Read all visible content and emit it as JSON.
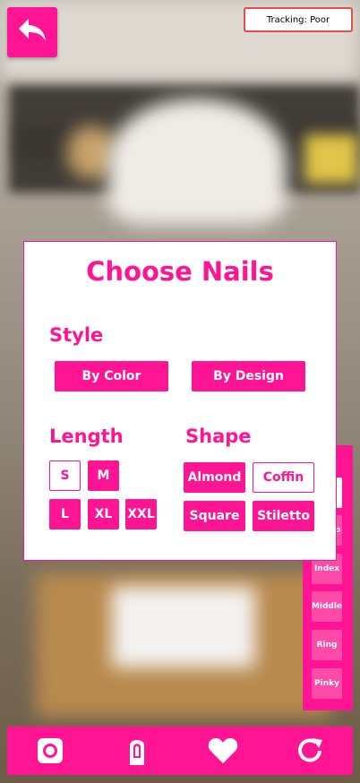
{
  "tracking": {
    "label": "Tracking: Poor"
  },
  "panel": {
    "title": "Choose Nails",
    "style": {
      "label": "Style",
      "options": [
        "By Color",
        "By Design"
      ]
    },
    "length": {
      "label": "Length",
      "options": [
        "S",
        "M",
        "L",
        "XL",
        "XXL"
      ],
      "selected": "S"
    },
    "shape": {
      "label": "Shape",
      "options": [
        "Almond",
        "Coffin",
        "Square",
        "Stiletto"
      ],
      "selected": "Coffin"
    }
  },
  "fingers": {
    "items": [
      "b",
      "Index",
      "Middle",
      "Ring",
      "Pinky"
    ]
  },
  "toolbar": {
    "icons": [
      "camera-icon",
      "nail-icon",
      "heart-icon",
      "refresh-icon"
    ]
  },
  "colors": {
    "accent": "#ff1493",
    "accent_light": "#ff4aa8",
    "tracking_border": "#e84b4b"
  }
}
